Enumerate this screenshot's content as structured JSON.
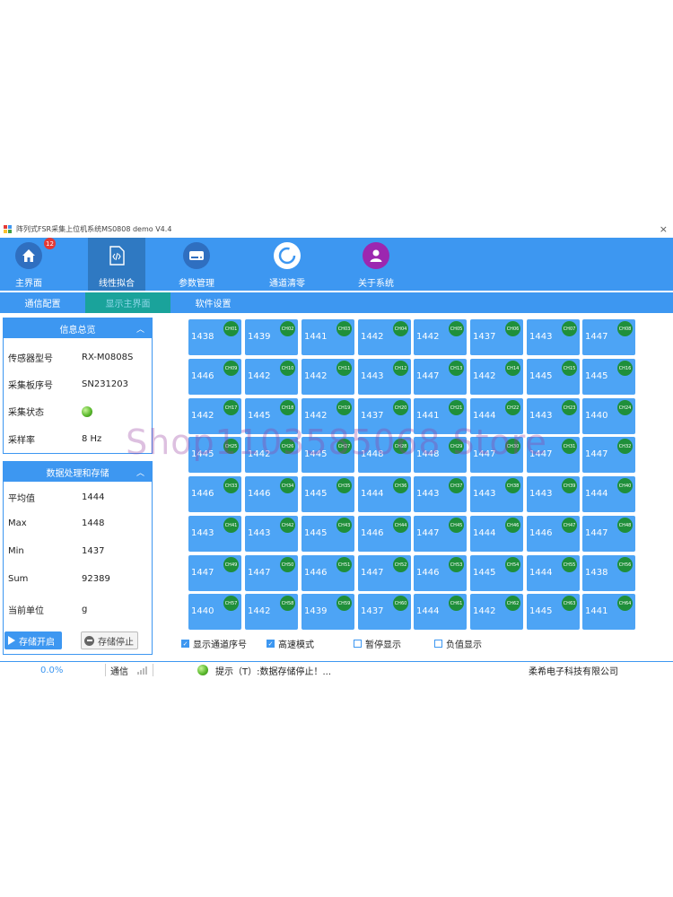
{
  "window": {
    "title": "阵列式FSR采集上位机系统MS0808 demo V4.4",
    "close_glyph": "×"
  },
  "toolbar": {
    "items": [
      {
        "label": "主界面",
        "icon": "home-icon",
        "badge": "12"
      },
      {
        "label": "线性拟合",
        "icon": "code-file-icon"
      },
      {
        "label": "参数管理",
        "icon": "drive-icon"
      },
      {
        "label": "通道清零",
        "icon": "refresh-ring-icon"
      },
      {
        "label": "关于系统",
        "icon": "user-icon"
      }
    ]
  },
  "tabs": [
    {
      "label": "通信配置"
    },
    {
      "label": "显示主界面",
      "active": true
    },
    {
      "label": "软件设置"
    }
  ],
  "info_panel": {
    "title": "信息总览",
    "rows": [
      {
        "label": "传感器型号",
        "value": "RX-M0808S"
      },
      {
        "label": "采集板序号",
        "value": "SN231203"
      },
      {
        "label": "采集状态",
        "value": ""
      },
      {
        "label": "采样率",
        "value": "8 Hz"
      }
    ]
  },
  "data_panel": {
    "title": "数据处理和存储",
    "rows": [
      {
        "label": "平均值",
        "value": "1444"
      },
      {
        "label": "Max",
        "value": "1448"
      },
      {
        "label": "Min",
        "value": "1437"
      },
      {
        "label": "Sum",
        "value": "92389"
      },
      {
        "label": "当前单位",
        "value": "g"
      }
    ],
    "start_button": "存储开启",
    "stop_button": "存储停止"
  },
  "channels": [
    {
      "ch": "CH01",
      "v": "1438"
    },
    {
      "ch": "CH02",
      "v": "1439"
    },
    {
      "ch": "CH03",
      "v": "1441"
    },
    {
      "ch": "CH04",
      "v": "1442"
    },
    {
      "ch": "CH05",
      "v": "1442"
    },
    {
      "ch": "CH06",
      "v": "1437"
    },
    {
      "ch": "CH07",
      "v": "1443"
    },
    {
      "ch": "CH08",
      "v": "1447"
    },
    {
      "ch": "CH09",
      "v": "1446"
    },
    {
      "ch": "CH10",
      "v": "1442"
    },
    {
      "ch": "CH11",
      "v": "1442"
    },
    {
      "ch": "CH12",
      "v": "1443"
    },
    {
      "ch": "CH13",
      "v": "1447"
    },
    {
      "ch": "CH14",
      "v": "1442"
    },
    {
      "ch": "CH15",
      "v": "1445"
    },
    {
      "ch": "CH16",
      "v": "1445"
    },
    {
      "ch": "CH17",
      "v": "1442"
    },
    {
      "ch": "CH18",
      "v": "1445"
    },
    {
      "ch": "CH19",
      "v": "1442"
    },
    {
      "ch": "CH20",
      "v": "1437"
    },
    {
      "ch": "CH21",
      "v": "1441"
    },
    {
      "ch": "CH22",
      "v": "1444"
    },
    {
      "ch": "CH23",
      "v": "1443"
    },
    {
      "ch": "CH24",
      "v": "1440"
    },
    {
      "ch": "CH25",
      "v": "1445"
    },
    {
      "ch": "CH26",
      "v": "1442"
    },
    {
      "ch": "CH27",
      "v": "1445"
    },
    {
      "ch": "CH28",
      "v": "1448"
    },
    {
      "ch": "CH29",
      "v": "1448"
    },
    {
      "ch": "CH30",
      "v": "1447"
    },
    {
      "ch": "CH31",
      "v": "1447"
    },
    {
      "ch": "CH32",
      "v": "1447"
    },
    {
      "ch": "CH33",
      "v": "1446"
    },
    {
      "ch": "CH34",
      "v": "1446"
    },
    {
      "ch": "CH35",
      "v": "1445"
    },
    {
      "ch": "CH36",
      "v": "1444"
    },
    {
      "ch": "CH37",
      "v": "1443"
    },
    {
      "ch": "CH38",
      "v": "1443"
    },
    {
      "ch": "CH39",
      "v": "1443"
    },
    {
      "ch": "CH40",
      "v": "1444"
    },
    {
      "ch": "CH41",
      "v": "1443"
    },
    {
      "ch": "CH42",
      "v": "1443"
    },
    {
      "ch": "CH43",
      "v": "1445"
    },
    {
      "ch": "CH44",
      "v": "1446"
    },
    {
      "ch": "CH45",
      "v": "1447"
    },
    {
      "ch": "CH46",
      "v": "1444"
    },
    {
      "ch": "CH47",
      "v": "1446"
    },
    {
      "ch": "CH48",
      "v": "1447"
    },
    {
      "ch": "CH49",
      "v": "1447"
    },
    {
      "ch": "CH50",
      "v": "1447"
    },
    {
      "ch": "CH51",
      "v": "1446"
    },
    {
      "ch": "CH52",
      "v": "1447"
    },
    {
      "ch": "CH53",
      "v": "1446"
    },
    {
      "ch": "CH54",
      "v": "1445"
    },
    {
      "ch": "CH55",
      "v": "1444"
    },
    {
      "ch": "CH56",
      "v": "1438"
    },
    {
      "ch": "CH57",
      "v": "1440"
    },
    {
      "ch": "CH58",
      "v": "1442"
    },
    {
      "ch": "CH59",
      "v": "1439"
    },
    {
      "ch": "CH60",
      "v": "1437"
    },
    {
      "ch": "CH61",
      "v": "1444"
    },
    {
      "ch": "CH62",
      "v": "1442"
    },
    {
      "ch": "CH63",
      "v": "1445"
    },
    {
      "ch": "CH64",
      "v": "1441"
    }
  ],
  "options": [
    {
      "label": "显示通道序号",
      "checked": true
    },
    {
      "label": "高速模式",
      "checked": true
    },
    {
      "label": "暂停显示",
      "checked": false
    },
    {
      "label": "负值显示",
      "checked": false
    }
  ],
  "status": {
    "progress": "0.0%",
    "comm_label": "通信",
    "message": "提示（T）:数据存储停止！...",
    "company": "柔希电子科技有限公司"
  },
  "watermark": "Shop1103585068 Store",
  "colors": {
    "accent": "#3d97f1",
    "active_tool": "#2f79c2",
    "active_tab": "#1aa39b",
    "cell": "#4da4f5",
    "channel_badge": "#1f8f3a",
    "status_led": "#5dbb2e"
  }
}
